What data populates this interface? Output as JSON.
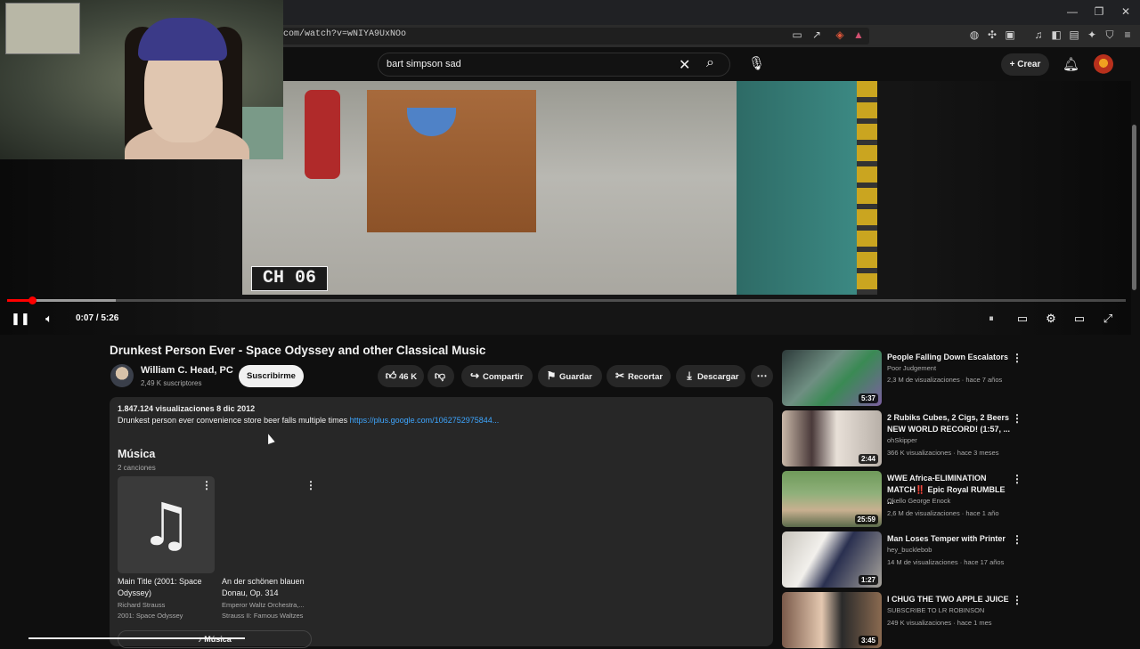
{
  "browser": {
    "url": "com/watch?v=wNIYA9UxNOo",
    "window_controls": [
      "minimize",
      "restore",
      "close"
    ]
  },
  "header": {
    "search_value": "bart simpson sad",
    "create_label": "Crear",
    "notification_badge": ""
  },
  "player": {
    "overlay_text": "CH 06",
    "time_display": "0:07 / 5:26",
    "progress_fraction": 0.0224,
    "buffered_fraction": 0.097,
    "accent": "#ff0000"
  },
  "video": {
    "title": "Drunkest Person Ever - Space Odyssey and other Classical Music",
    "channel_name": "William C. Head, PC",
    "subscribers": "2,49 K suscriptores",
    "subscribe_label": "Suscribirme",
    "likes": "46 K",
    "share_label": "Compartir",
    "save_label": "Guardar",
    "clip_label": "Recortar",
    "download_label": "Descargar"
  },
  "description": {
    "stats": "1.847.124 visualizaciones  8 dic 2012",
    "text": "Drunkest person ever convenience store beer falls multiple times ",
    "link": "https://plus.google.com/1062752975844..."
  },
  "music": {
    "heading": "Música",
    "count": "2 canciones",
    "button_label": "Música",
    "songs": [
      {
        "title": "Main Title (2001: Space Odyssey)",
        "artist": "Richard Strauss",
        "album": "2001: Space Odyssey"
      },
      {
        "title": "An der schönen blauen Donau, Op. 314",
        "artist": "Emperor Waltz Orchestra,...",
        "album": "Strauss II: Famous Waltzes"
      }
    ]
  },
  "recommendations": [
    {
      "title": "People Falling Down Escalators",
      "channel": "Poor Judgement",
      "stats": "2,3 M de visualizaciones · hace 7 años",
      "duration": "5:37"
    },
    {
      "title": "2 Rubiks Cubes, 2 Cigs, 2 Beers NEW WORLD RECORD! (1:57, ...",
      "channel": "ohSkipper",
      "stats": "366 K visualizaciones · hace 3 meses",
      "duration": "2:44"
    },
    {
      "title": "WWE  Africa-ELIMINATION MATCH‼️ Epic Royal RUMBLE ...",
      "channel": "Okello George Enock",
      "stats": "2,6 M de visualizaciones · hace 1 año",
      "duration": "25:59"
    },
    {
      "title": "Man Loses Temper with Printer",
      "channel": "hey_bucklebob",
      "stats": "14 M de visualizaciones · hace 17 años",
      "duration": "1:27"
    },
    {
      "title": "I CHUG THE TWO APPLE JUICE",
      "channel": "SUBSCRIBE TO LR ROBINSON",
      "stats": "249 K visualizaciones · hace 1 mes",
      "duration": "3:45"
    }
  ]
}
